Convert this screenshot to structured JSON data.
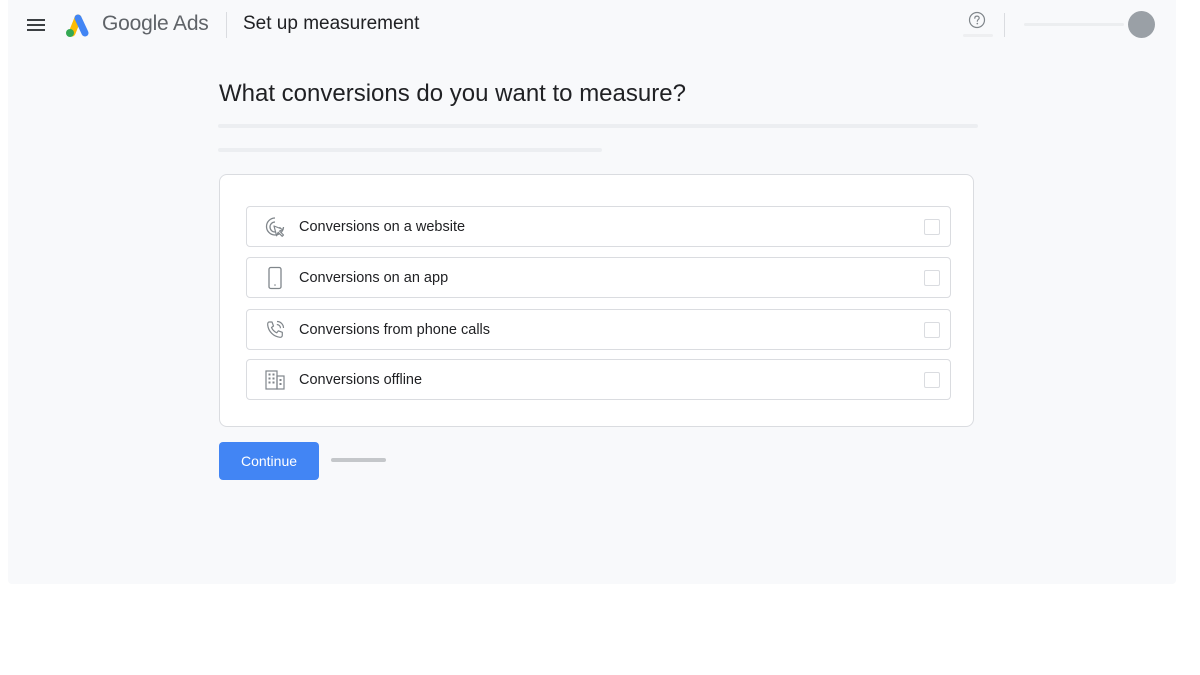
{
  "header": {
    "brand_prefix": "Google",
    "brand_suffix": " Ads",
    "page_title": "Set up measurement",
    "help_icon": "help-circle-icon",
    "menu_icon": "hamburger-menu-icon"
  },
  "main": {
    "question": "What conversions do you want to measure?",
    "options": [
      {
        "label": "Conversions on a website",
        "icon": "cursor-click-icon",
        "checked": false
      },
      {
        "label": "Conversions on an app",
        "icon": "smartphone-icon",
        "checked": false
      },
      {
        "label": "Conversions from phone calls",
        "icon": "phone-call-icon",
        "checked": false
      },
      {
        "label": "Conversions offline",
        "icon": "building-icon",
        "checked": false
      }
    ],
    "continue_label": "Continue"
  },
  "colors": {
    "primary": "#4285f4",
    "background": "#f8f9fb",
    "border": "#dadce0",
    "logo_blue": "#4285f4",
    "logo_yellow": "#fbbc04",
    "logo_green": "#34a853"
  }
}
